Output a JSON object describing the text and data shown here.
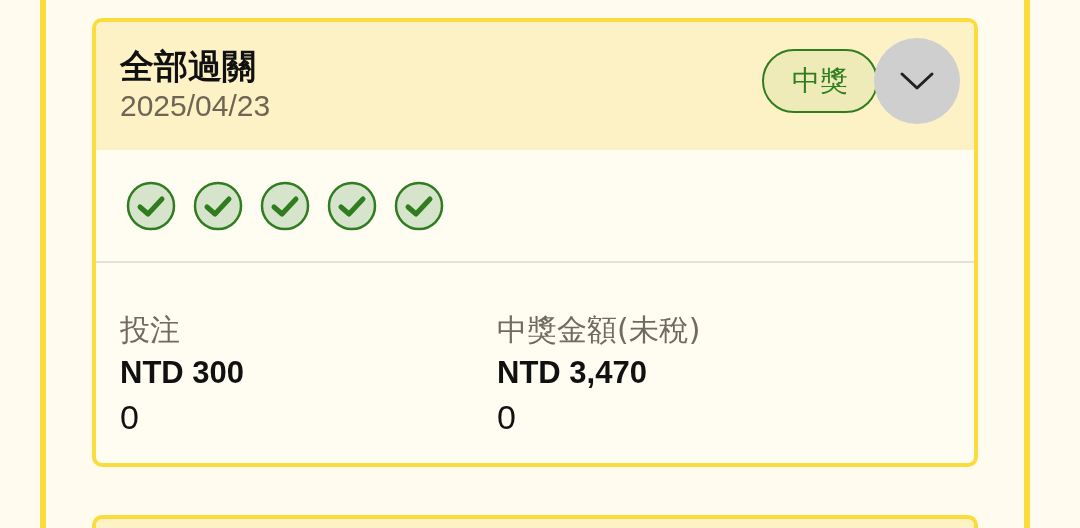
{
  "cards": [
    {
      "title": "全部過關",
      "date": "2025/04/23",
      "status": {
        "kind": "won",
        "label": "中獎"
      },
      "expanded": false,
      "legs": [
        {
          "won": true
        },
        {
          "won": true
        },
        {
          "won": true
        },
        {
          "won": true
        },
        {
          "won": true
        }
      ],
      "stats": [
        {
          "label": "投注",
          "amount": "NTD 300",
          "extra": "0"
        },
        {
          "label": "中獎金額(未稅)",
          "amount": "NTD 3,470",
          "extra": "0"
        }
      ]
    }
  ]
}
